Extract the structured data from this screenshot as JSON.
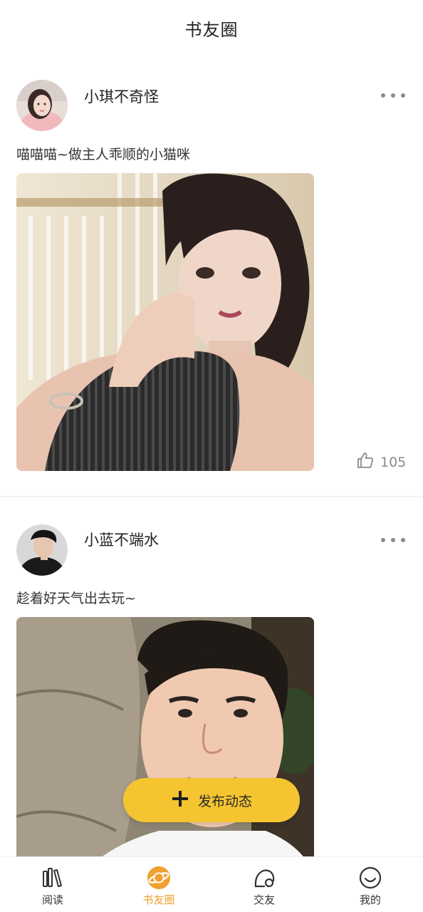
{
  "header": {
    "title": "书友圈"
  },
  "posts": [
    {
      "author": "小琪不奇怪",
      "text": "喵喵喵~做主人乖顺的小猫咪",
      "likes": "105"
    },
    {
      "author": "小蓝不端水",
      "text": "趁着好天气出去玩~"
    }
  ],
  "fab": {
    "label": "发布动态"
  },
  "tabbar": {
    "items": [
      {
        "label": "阅读",
        "icon": "bookshelf-icon"
      },
      {
        "label": "书友圈",
        "icon": "planet-icon",
        "active": true
      },
      {
        "label": "交友",
        "icon": "friends-icon"
      },
      {
        "label": "我的",
        "icon": "smile-icon"
      }
    ]
  },
  "colors": {
    "accent": "#f4c531",
    "active_tab": "#f0a030",
    "muted": "#8a8a8a"
  }
}
